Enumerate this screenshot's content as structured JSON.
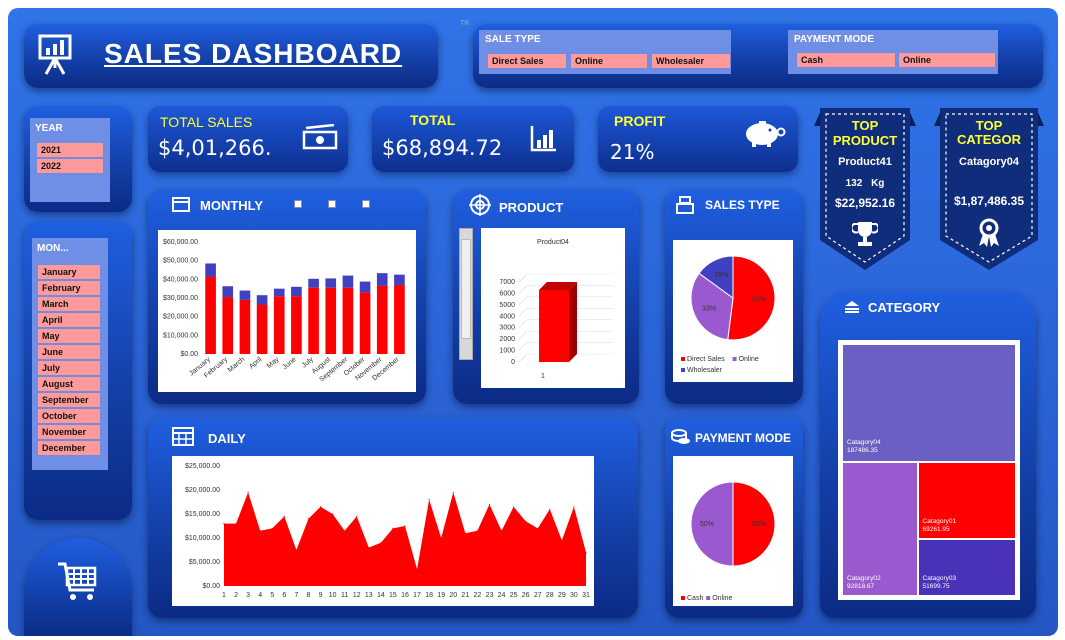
{
  "header": {
    "title": "SALES DASHBOARD",
    "tiny_mark": "TR"
  },
  "sale_type": {
    "title": "SALE TYPE",
    "options": [
      "Direct Sales",
      "Online",
      "Wholesaler"
    ]
  },
  "payment_mode_slicer": {
    "title": "PAYMENT MODE",
    "options": [
      "Cash",
      "Online"
    ]
  },
  "year": {
    "title": "YEAR",
    "options": [
      "2021",
      "2022"
    ]
  },
  "month": {
    "title": "MON...",
    "options": [
      "January",
      "February",
      "March",
      "April",
      "May",
      "June",
      "July",
      "August",
      "September",
      "October",
      "November",
      "December"
    ]
  },
  "kpis": {
    "total_sales": {
      "label": "TOTAL SALES",
      "value": "$4,01,266."
    },
    "total": {
      "label": "TOTAL",
      "value": "$68,894.72"
    },
    "profit": {
      "label": "PROFIT",
      "value": "21%"
    }
  },
  "top_product": {
    "l1": "TOP",
    "l2": "PRODUCT",
    "name": "Product41",
    "qty": "132",
    "unit": "Kg",
    "amount": "$22,952.16"
  },
  "top_category": {
    "l1": "TOP",
    "l2": "CATEGOR",
    "name": "Catagory04",
    "amount": "$1,87,486.35"
  },
  "panels": {
    "monthly": "MONTHLY",
    "product": "PRODUCT",
    "sales_type": "SALES TYPE",
    "daily": "DAILY",
    "payment_mode": "PAYMENT MODE",
    "category": "CATEGORY"
  },
  "colors": {
    "red": "#ff0000",
    "blue": "#4040c0",
    "purple": "#9b59d0",
    "chip": "#ff9a9a",
    "yellow": "#ffff33"
  },
  "chart_data": [
    {
      "id": "monthly",
      "type": "bar",
      "categories": [
        "January",
        "February",
        "March",
        "April",
        "May",
        "June",
        "July",
        "August",
        "September",
        "October",
        "November",
        "December"
      ],
      "series": [
        {
          "values": [
            41500,
            30500,
            29000,
            26500,
            31000,
            31000,
            35500,
            35500,
            35500,
            33000,
            36500,
            37000
          ]
        },
        {
          "values": [
            7000,
            5800,
            5000,
            5000,
            4000,
            5000,
            4800,
            5000,
            6500,
            5800,
            6800,
            5500
          ]
        }
      ],
      "ylim": [
        0,
        60000
      ],
      "yticks": [
        "$0.00",
        "$10,000.00",
        "$20,000.00",
        "$30,000.00",
        "$40,000.00",
        "$50,000.00",
        "$60,000.00"
      ],
      "grid": false
    },
    {
      "id": "product",
      "type": "bar",
      "title": "Product04",
      "categories": [
        "1"
      ],
      "values": [
        6300
      ],
      "ylim": [
        0,
        7000
      ],
      "yticks": [
        "0",
        "1000",
        "2000",
        "3000",
        "4000",
        "5000",
        "6000",
        "7000"
      ]
    },
    {
      "id": "sales_type",
      "type": "pie",
      "labels": [
        "Direct Sales",
        "Online",
        "Wholesaler"
      ],
      "values": [
        52,
        33,
        15
      ],
      "data_labels": [
        "52%",
        "33%",
        "15%"
      ],
      "legend": "bottom"
    },
    {
      "id": "daily",
      "type": "area",
      "x": [
        1,
        2,
        3,
        4,
        5,
        6,
        7,
        8,
        9,
        10,
        11,
        12,
        13,
        14,
        15,
        16,
        17,
        18,
        19,
        20,
        21,
        22,
        23,
        24,
        25,
        26,
        27,
        28,
        29,
        30,
        31
      ],
      "values": [
        13000,
        13000,
        19500,
        11500,
        12000,
        14500,
        7500,
        14000,
        16500,
        15000,
        11500,
        14500,
        8000,
        9000,
        12000,
        12500,
        3500,
        18000,
        10000,
        19500,
        11000,
        11500,
        17000,
        11500,
        16500,
        13500,
        12000,
        16000,
        9500,
        16500,
        7000
      ],
      "ylim": [
        0,
        25000
      ],
      "yticks": [
        "$0.00",
        "$5,000.00",
        "$10,000.00",
        "$15,000.00",
        "$20,000.00",
        "$25,000.00"
      ]
    },
    {
      "id": "payment_mode",
      "type": "pie",
      "labels": [
        "Cash",
        "Online"
      ],
      "values": [
        50,
        50
      ],
      "data_labels": [
        "50%",
        "50%"
      ],
      "legend": "bottom"
    },
    {
      "id": "category",
      "type": "heatmap",
      "items": [
        {
          "name": "Catagory04",
          "value": "187486.35",
          "v": 187486.35
        },
        {
          "name": "Catagory02",
          "value": "92818.67",
          "v": 92818.67
        },
        {
          "name": "Catagory01",
          "value": "69261.95",
          "v": 69261.95
        },
        {
          "name": "Catagory03",
          "value": "51699.75",
          "v": 51699.75
        }
      ]
    }
  ]
}
